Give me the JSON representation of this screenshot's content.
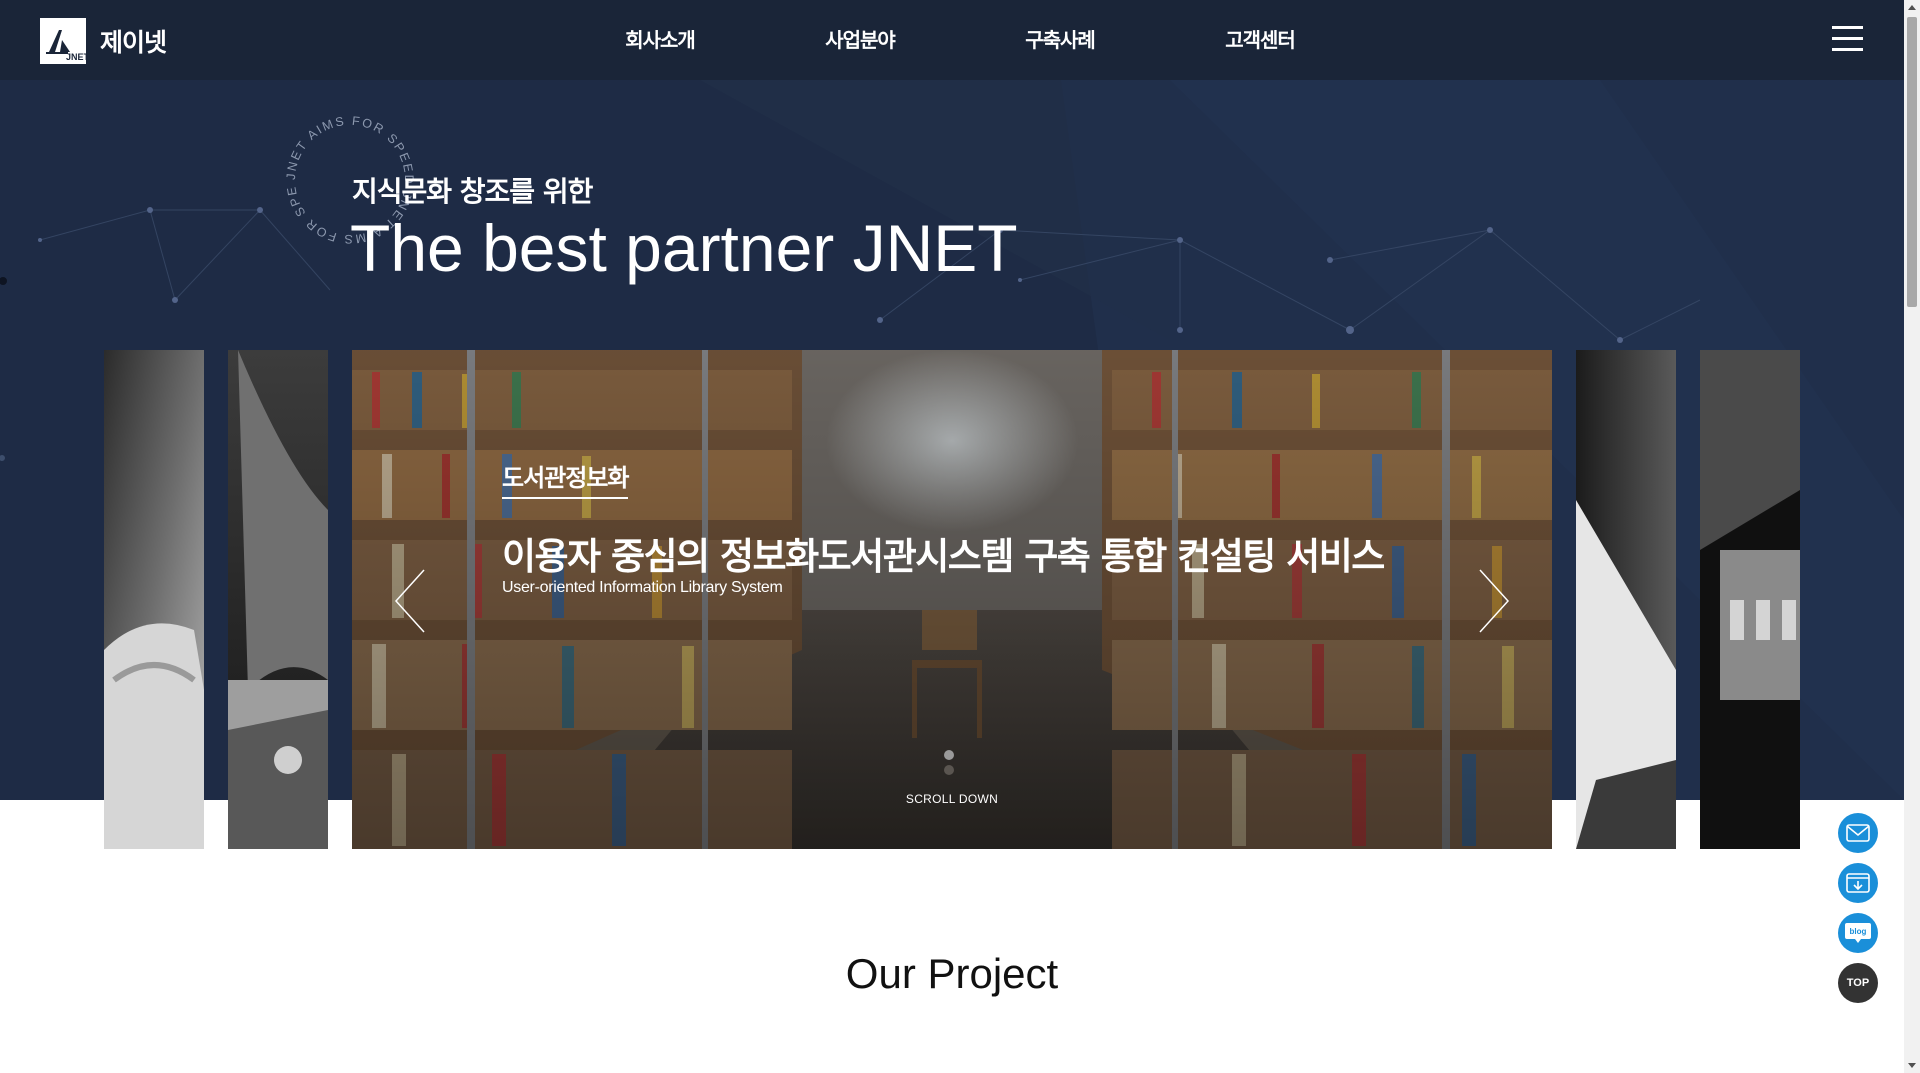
{
  "header": {
    "logo_name": "제이넷",
    "logo_mark_text": "JNET",
    "nav": [
      "회사소개",
      "사업분야",
      "구축사례",
      "고객센터"
    ]
  },
  "hero": {
    "badge_text": "JNET AIMS FOR SPEED JNET AIMS FOR SPEED",
    "subtitle": "지식문화 창조를 위한",
    "title": "The best partner JNET"
  },
  "slide": {
    "category": "도서관정보화",
    "headline": "이용자 중심의 정보화도서관시스템 구축 통합 컨설팅 서비스",
    "subheadline": "User-oriented Information Library System",
    "scroll_label": "SCROLL DOWN",
    "active_index": 1,
    "total": 2
  },
  "section": {
    "title": "Our Project"
  },
  "float": {
    "top_label": "TOP",
    "blog_label": "blog"
  },
  "colors": {
    "hero_bg": "#1e2b45",
    "header_bg": "#1a2538",
    "float_blue": "#1a8fd9",
    "float_dark": "#333333"
  }
}
